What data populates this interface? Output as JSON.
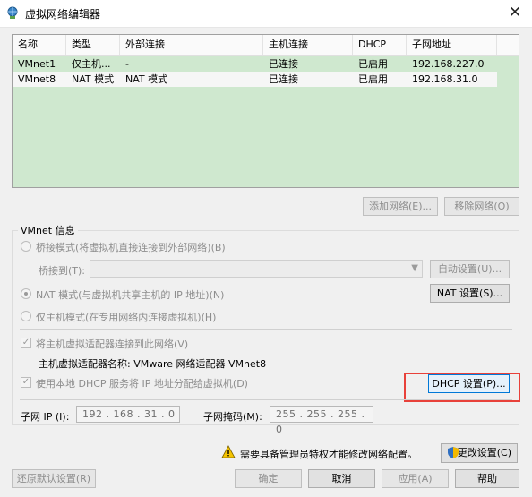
{
  "window": {
    "title": "虚拟网络编辑器",
    "close_glyph": "✕"
  },
  "table": {
    "headers": [
      "名称",
      "类型",
      "外部连接",
      "主机连接",
      "DHCP",
      "子网地址"
    ],
    "rows": [
      [
        "VMnet1",
        "仅主机...",
        "-",
        "已连接",
        "已启用",
        "192.168.227.0"
      ],
      [
        "VMnet8",
        "NAT 模式",
        "NAT 模式",
        "已连接",
        "已启用",
        "192.168.31.0"
      ]
    ],
    "selected_row": 1
  },
  "list_buttons": {
    "add": "添加网络(E)...",
    "remove": "移除网络(O)"
  },
  "vmnet_info": {
    "legend": "VMnet 信息",
    "bridge_radio": "桥接模式(将虚拟机直接连接到外部网络)(B)",
    "bridge_to_label": "桥接到(T):",
    "bridge_to_value": "",
    "auto_settings": "自动设置(U)...",
    "nat_radio": "NAT 模式(与虚拟机共享主机的 IP 地址)(N)",
    "nat_settings": "NAT 设置(S)...",
    "hostonly_radio": "仅主机模式(在专用网络内连接虚拟机)(H)",
    "connect_adapter_check": "将主机虚拟适配器连接到此网络(V)",
    "adapter_name_text": "主机虚拟适配器名称: VMware 网络适配器 VMnet8",
    "dhcp_check": "使用本地 DHCP 服务将 IP 地址分配给虚拟机(D)",
    "dhcp_settings": "DHCP 设置(P)...",
    "subnet_ip_label": "子网 IP (I):",
    "subnet_ip_value": "192 . 168 . 31 . 0",
    "subnet_mask_label": "子网掩码(M):",
    "subnet_mask_value": "255 . 255 . 255 . 0"
  },
  "footer": {
    "admin_notice": "需要具备管理员特权才能修改网络配置。",
    "change_settings": "更改设置(C)",
    "restore_defaults": "还原默认设置(R)",
    "ok": "确定",
    "cancel": "取消",
    "apply": "应用(A)",
    "help": "帮助"
  },
  "colors": {
    "list_bg": "#cfe8cf",
    "highlight": "#e8413a",
    "focus": "#0078d7"
  }
}
